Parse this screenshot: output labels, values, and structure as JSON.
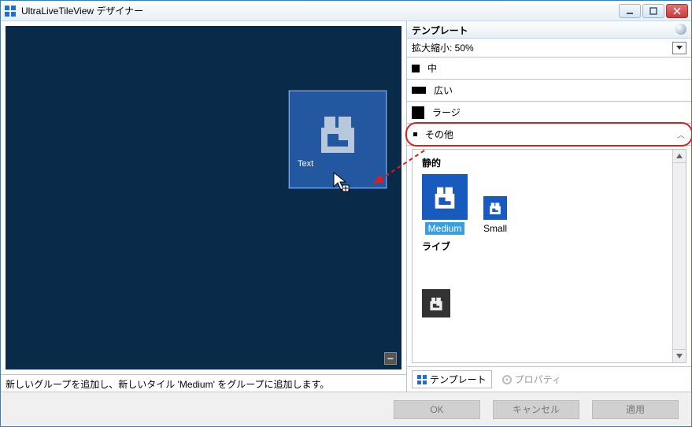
{
  "window": {
    "title": "UltraLiveTileView デザイナー"
  },
  "canvas": {
    "tile_text": "Text"
  },
  "hint": "新しいグループを追加し、新しいタイル 'Medium' をグループに追加します。",
  "panel": {
    "header": "テンプレート",
    "zoom_label": "拡大縮小: 50%",
    "sizes": {
      "medium": "中",
      "wide": "広い",
      "large": "ラージ"
    },
    "other": "その他",
    "gallery": {
      "static_header": "静的",
      "live_header": "ライブ",
      "medium_label": "Medium",
      "small_label": "Small"
    }
  },
  "tabs": {
    "templates": "テンプレート",
    "properties": "プロパティ"
  },
  "buttons": {
    "ok": "OK",
    "cancel": "キャンセル",
    "apply": "適用"
  },
  "colors": {
    "tile_blue": "#185abd",
    "canvas_navy": "#0a2a4a",
    "highlight_red": "#d81e1e"
  }
}
